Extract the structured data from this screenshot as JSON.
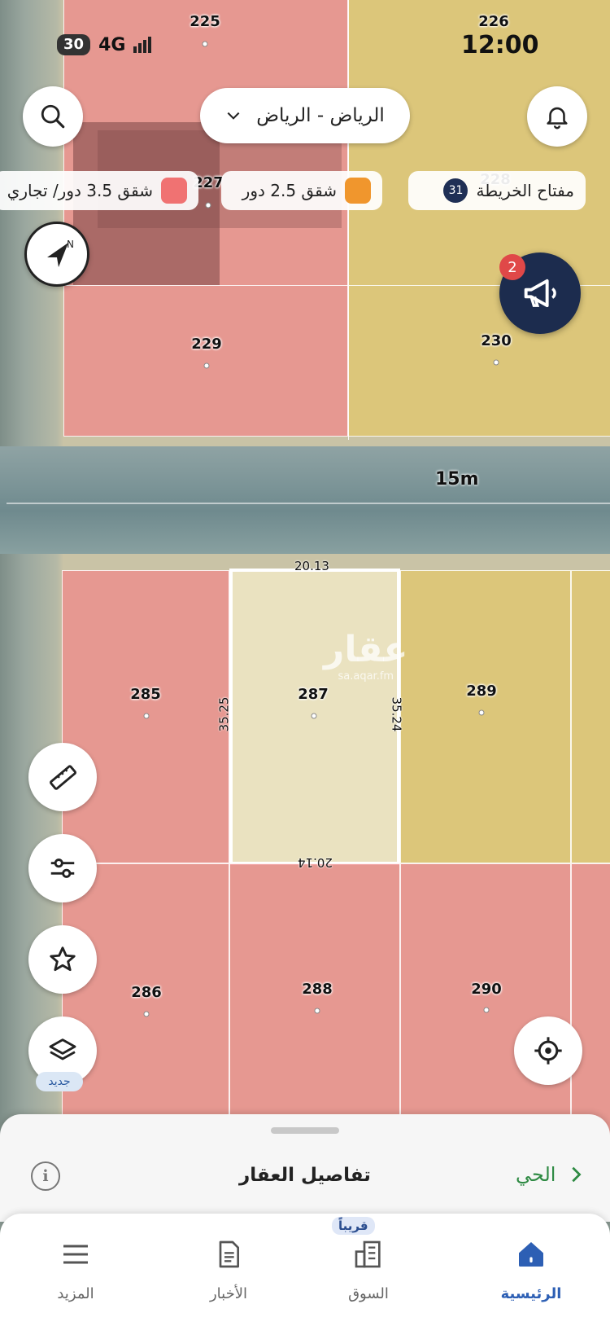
{
  "status_bar": {
    "battery": "30",
    "network": "4G",
    "time": "12:00"
  },
  "top_bar": {
    "city_selector": "الرياض - الرياض"
  },
  "legend": {
    "map_key_label": "مفتاح الخريطة",
    "map_key_count": "31",
    "orange_item": "شقق 2.5 دور",
    "red_item": "شقق 3.5 دور/ تجاري"
  },
  "announcements": {
    "count": "2"
  },
  "map": {
    "road_width": "15m",
    "watermark": "عقار",
    "watermark_url": "sa.aqar.fm",
    "parcels": {
      "p225": "225",
      "p226": "226",
      "p227": "227",
      "p228": "228",
      "p229": "229",
      "p230": "230",
      "p285": "285",
      "p286": "286",
      "p287": "287",
      "p288": "288",
      "p289": "289",
      "p290": "290"
    },
    "dimensions": {
      "top": "20.13",
      "bottom": "20.14",
      "left": "35.25",
      "right": "35.24"
    }
  },
  "tools": {
    "new_tag": "جديد"
  },
  "sheet": {
    "title": "تفاصيل العقار",
    "neighborhood_link": "الحي"
  },
  "tabs": {
    "home": "الرئيسية",
    "market": "السوق",
    "market_badge": "قريباً",
    "news": "الأخبار",
    "more": "المزيد"
  },
  "colors": {
    "red_zone": "#ee8c8c",
    "orange_zone": "#f0962d",
    "red_swatch": "#f07272",
    "accent": "#2d5fb4",
    "link_green": "#2e8a43"
  }
}
